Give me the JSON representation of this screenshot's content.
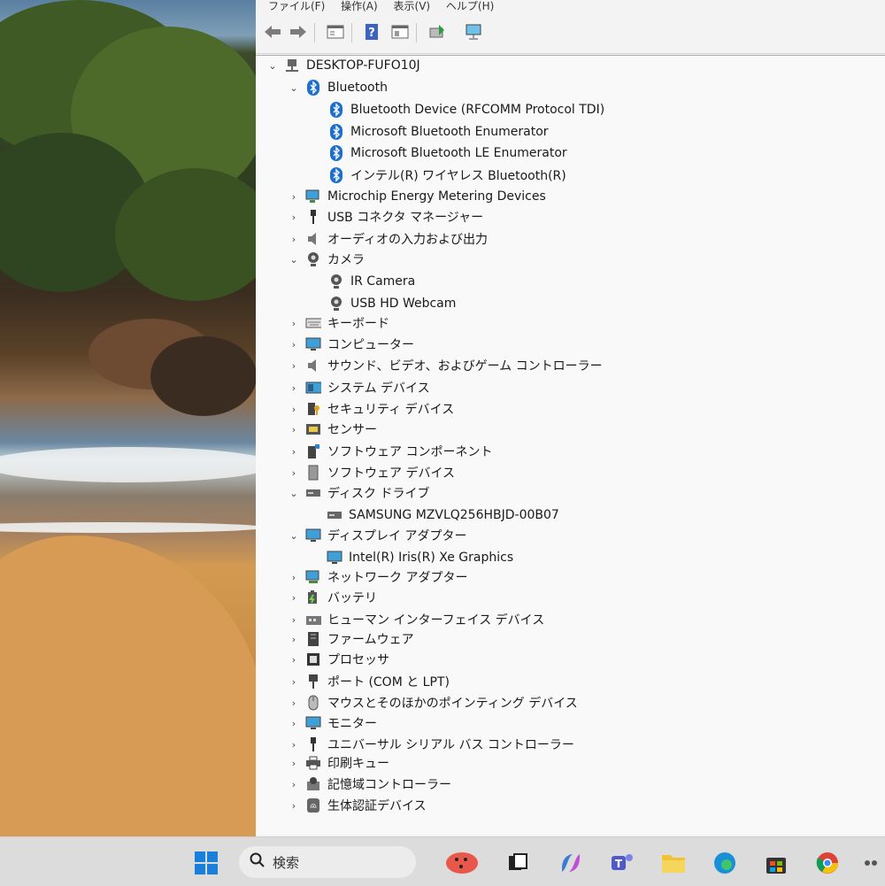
{
  "menubar": {
    "items": [
      "ファイル(F)",
      "操作(A)",
      "表示(V)",
      "ヘルプ(H)"
    ]
  },
  "toolbar": {
    "buttons": [
      "back-icon",
      "forward-icon",
      "properties-icon",
      "help-icon",
      "view-icon",
      "update-driver-icon",
      "scan-hardware-icon"
    ]
  },
  "tree": {
    "root": "DESKTOP-FUFO10J",
    "bluetooth": "Bluetooth",
    "bt_devices": [
      "Bluetooth Device (RFCOMM Protocol TDI)",
      "Microsoft Bluetooth Enumerator",
      "Microsoft Bluetooth LE Enumerator",
      "インテル(R) ワイヤレス Bluetooth(R)"
    ],
    "microchip": "Microchip Energy Metering Devices",
    "usb_connector": "USB コネクタ マネージャー",
    "audio_io": "オーディオの入力および出力",
    "camera": "カメラ",
    "cameras": [
      "IR Camera",
      "USB HD Webcam"
    ],
    "keyboard": "キーボード",
    "computer": "コンピューター",
    "sound": "サウンド、ビデオ、およびゲーム コントローラー",
    "system": "システム デバイス",
    "security": "セキュリティ デバイス",
    "sensor": "センサー",
    "sw_component": "ソフトウェア コンポーネント",
    "sw_device": "ソフトウェア デバイス",
    "disk": "ディスク ドライブ",
    "disks": [
      "SAMSUNG MZVLQ256HBJD-00B07"
    ],
    "display": "ディスプレイ アダプター",
    "displays": [
      "Intel(R) Iris(R) Xe Graphics"
    ],
    "network": "ネットワーク アダプター",
    "battery": "バッテリ",
    "hid": "ヒューマン インターフェイス デバイス",
    "firmware": "ファームウェア",
    "processor": "プロセッサ",
    "port": "ポート (COM と LPT)",
    "mouse": "マウスとそのほかのポインティング デバイス",
    "monitor": "モニター",
    "usb_controller": "ユニバーサル シリアル バス コントローラー",
    "print_queue": "印刷キュー",
    "storage": "記憶域コントローラー",
    "biometric": "生体認証デバイス"
  },
  "taskbar": {
    "search_placeholder": "検索"
  }
}
